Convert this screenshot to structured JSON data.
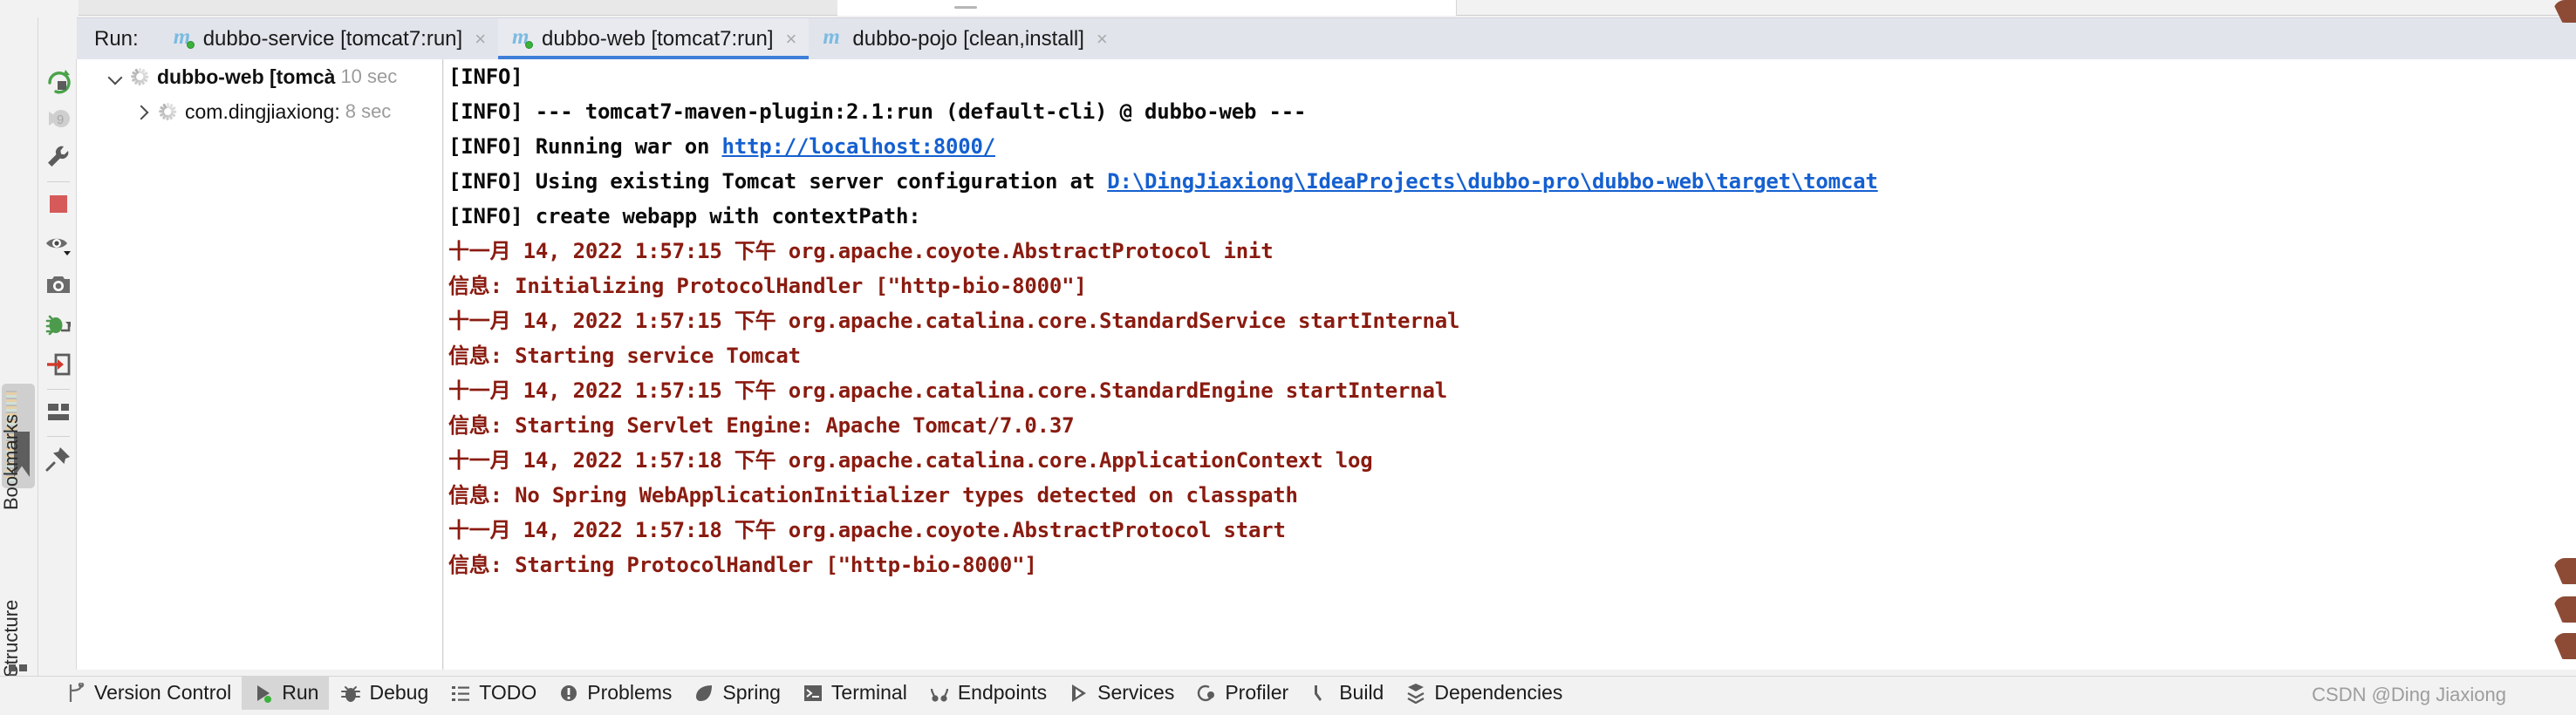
{
  "window": {
    "run_label": "Run:"
  },
  "tabs": [
    {
      "label": "dubbo-service [tomcat7:run]",
      "icon": "maven-m-icon",
      "close": "×",
      "active": false,
      "running": true
    },
    {
      "label": "dubbo-web [tomcat7:run]",
      "icon": "maven-m-icon",
      "close": "×",
      "active": true,
      "running": true
    },
    {
      "label": "dubbo-pojo [clean,install]",
      "icon": "maven-m-icon",
      "close": "×",
      "active": false,
      "running": false
    }
  ],
  "run_toolbar": {
    "icons": [
      {
        "name": "rerun-icon",
        "title": "Rerun"
      },
      {
        "name": "resume-program-icon",
        "title": "Resume Program"
      },
      {
        "name": "settings-wrench-icon",
        "title": "Settings"
      },
      {
        "name": "stop-icon",
        "title": "Stop"
      },
      {
        "name": "eye-soft-wrap-icon",
        "title": "Soft-Wrap"
      },
      {
        "name": "camera-print-icon",
        "title": "Print"
      },
      {
        "name": "debug-bug-icon",
        "title": "Debug"
      },
      {
        "name": "export-icon",
        "title": "Export"
      },
      {
        "name": "layout-icon",
        "title": "Layout"
      },
      {
        "name": "pin-icon",
        "title": "Pin Tab"
      }
    ]
  },
  "left_rail": {
    "bookmarks_label": "Bookmarks",
    "structure_label": "Structure"
  },
  "tree": {
    "rows": [
      {
        "label": "dubbo-web [tomcà",
        "time": "10 sec",
        "expanded": true,
        "bold": true,
        "indent": 0
      },
      {
        "label": "com.dingjiaxiong:",
        "time": "8 sec",
        "expanded": false,
        "bold": false,
        "indent": 1
      }
    ]
  },
  "console": {
    "lines": [
      {
        "type": "info",
        "text": "[INFO]"
      },
      {
        "type": "info",
        "text": "[INFO] --- tomcat7-maven-plugin:2.1:run (default-cli) @ dubbo-web ---"
      },
      {
        "type": "info-link",
        "text": "[INFO] Running war on ",
        "link": "http://localhost:8000/"
      },
      {
        "type": "info-link",
        "text": "[INFO] Using existing Tomcat server configuration at ",
        "link": "D:\\DingJiaxiong\\IdeaProjects\\dubbo-pro\\dubbo-web\\target\\tomcat"
      },
      {
        "type": "info",
        "text": "[INFO] create webapp with contextPath:"
      },
      {
        "type": "red",
        "text": "十一月 14, 2022 1:57:15 下午 org.apache.coyote.AbstractProtocol init"
      },
      {
        "type": "red",
        "text": "信息: Initializing ProtocolHandler [\"http-bio-8000\"]"
      },
      {
        "type": "red",
        "text": "十一月 14, 2022 1:57:15 下午 org.apache.catalina.core.StandardService startInternal"
      },
      {
        "type": "red",
        "text": "信息: Starting service Tomcat"
      },
      {
        "type": "red",
        "text": "十一月 14, 2022 1:57:15 下午 org.apache.catalina.core.StandardEngine startInternal"
      },
      {
        "type": "red",
        "text": "信息: Starting Servlet Engine: Apache Tomcat/7.0.37"
      },
      {
        "type": "red",
        "text": "十一月 14, 2022 1:57:18 下午 org.apache.catalina.core.ApplicationContext log"
      },
      {
        "type": "red",
        "text": "信息: No Spring WebApplicationInitializer types detected on classpath"
      },
      {
        "type": "red",
        "text": "十一月 14, 2022 1:57:18 下午 org.apache.coyote.AbstractProtocol start"
      },
      {
        "type": "red",
        "text": "信息: Starting ProtocolHandler [\"http-bio-8000\"]"
      }
    ]
  },
  "bottom_bar": {
    "items": [
      {
        "label": "Version Control",
        "icon": "branch-icon",
        "active": false
      },
      {
        "label": "Run",
        "icon": "play-icon",
        "active": true
      },
      {
        "label": "Debug",
        "icon": "bug-icon",
        "active": false
      },
      {
        "label": "TODO",
        "icon": "list-icon",
        "active": false
      },
      {
        "label": "Problems",
        "icon": "error-circle-icon",
        "active": false
      },
      {
        "label": "Spring",
        "icon": "spring-leaf-icon",
        "active": false
      },
      {
        "label": "Terminal",
        "icon": "terminal-icon",
        "active": false
      },
      {
        "label": "Endpoints",
        "icon": "endpoints-icon",
        "active": false
      },
      {
        "label": "Services",
        "icon": "services-icon",
        "active": false
      },
      {
        "label": "Profiler",
        "icon": "profiler-icon",
        "active": false
      },
      {
        "label": "Build",
        "icon": "hammer-icon",
        "active": false
      },
      {
        "label": "Dependencies",
        "icon": "dependencies-icon",
        "active": false
      }
    ]
  },
  "watermark": {
    "text": "CSDN @Ding Jiaxiong"
  },
  "colors": {
    "tabbar_bg": "#e2e4ec",
    "active_tab_underline": "#3f7fd8",
    "console_info": "#0b0b0b",
    "console_red": "#8a1b10",
    "console_link": "#1560d0",
    "running_dot": "#3bb33b",
    "stop_red": "#d65a5a"
  }
}
